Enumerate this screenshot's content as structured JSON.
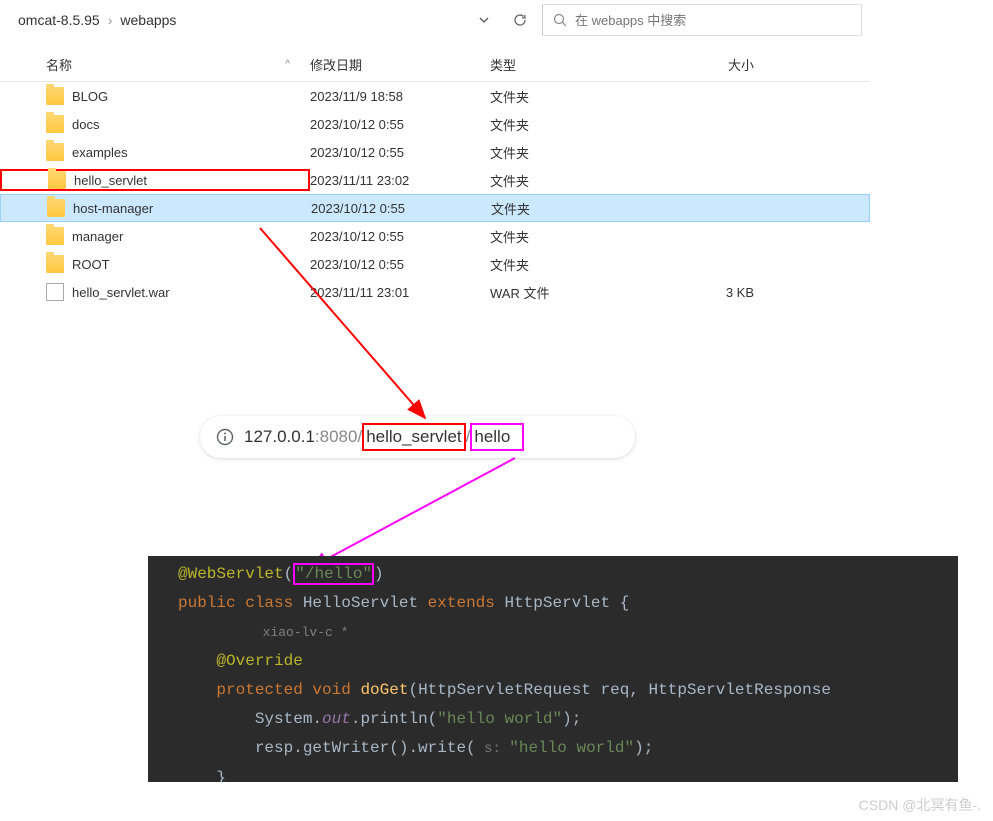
{
  "breadcrumb": {
    "part1": "omcat-8.5.95",
    "part2": "webapps"
  },
  "search": {
    "placeholder": "在 webapps 中搜索"
  },
  "columns": {
    "name": "名称",
    "date": "修改日期",
    "type": "类型",
    "size": "大小"
  },
  "files": [
    {
      "name": "BLOG",
      "date": "2023/11/9 18:58",
      "type": "文件夹",
      "size": "",
      "icon": "folder",
      "highlight": false,
      "selected": false
    },
    {
      "name": "docs",
      "date": "2023/10/12 0:55",
      "type": "文件夹",
      "size": "",
      "icon": "folder",
      "highlight": false,
      "selected": false
    },
    {
      "name": "examples",
      "date": "2023/10/12 0:55",
      "type": "文件夹",
      "size": "",
      "icon": "folder",
      "highlight": false,
      "selected": false
    },
    {
      "name": "hello_servlet",
      "date": "2023/11/11 23:02",
      "type": "文件夹",
      "size": "",
      "icon": "folder",
      "highlight": true,
      "selected": false
    },
    {
      "name": "host-manager",
      "date": "2023/10/12 0:55",
      "type": "文件夹",
      "size": "",
      "icon": "folder",
      "highlight": false,
      "selected": true
    },
    {
      "name": "manager",
      "date": "2023/10/12 0:55",
      "type": "文件夹",
      "size": "",
      "icon": "folder",
      "highlight": false,
      "selected": false
    },
    {
      "name": "ROOT",
      "date": "2023/10/12 0:55",
      "type": "文件夹",
      "size": "",
      "icon": "folder",
      "highlight": false,
      "selected": false
    },
    {
      "name": "hello_servlet.war",
      "date": "2023/11/11 23:01",
      "type": "WAR 文件",
      "size": "3 KB",
      "icon": "file",
      "highlight": false,
      "selected": false
    }
  ],
  "url": {
    "prefix": "127.0.0.1",
    "port": ":8080",
    "path1": "hello_servlet",
    "path2": "hello",
    "sep": "/"
  },
  "code": {
    "annotation": "@WebServlet",
    "annotation_arg": "\"/hello\"",
    "public": "public ",
    "class": "class ",
    "classname": "HelloServlet ",
    "extends": "extends ",
    "superclass": "HttpServlet ",
    "brace_open": "{",
    "author_icon": "👤",
    "author": " xiao-lv-c *",
    "override": "@Override",
    "protected": "protected ",
    "void": "void ",
    "doGet": "doGet",
    "paren_open": "(",
    "param1_type": "HttpServletRequest ",
    "param1_name": "req",
    "comma": ", ",
    "param2_type": "HttpServletResponse",
    "println_obj": "System.",
    "println_field": "out",
    "println_dot": ".",
    "println_method": "println",
    "println_arg": "\"hello world\"",
    "println_end": ");",
    "write_obj": "resp.getWriter().write(",
    "write_hint": " s: ",
    "write_arg": "\"hello world\"",
    "write_end": ");",
    "brace_close": "}"
  },
  "watermark": "CSDN @北冥有鱼-."
}
